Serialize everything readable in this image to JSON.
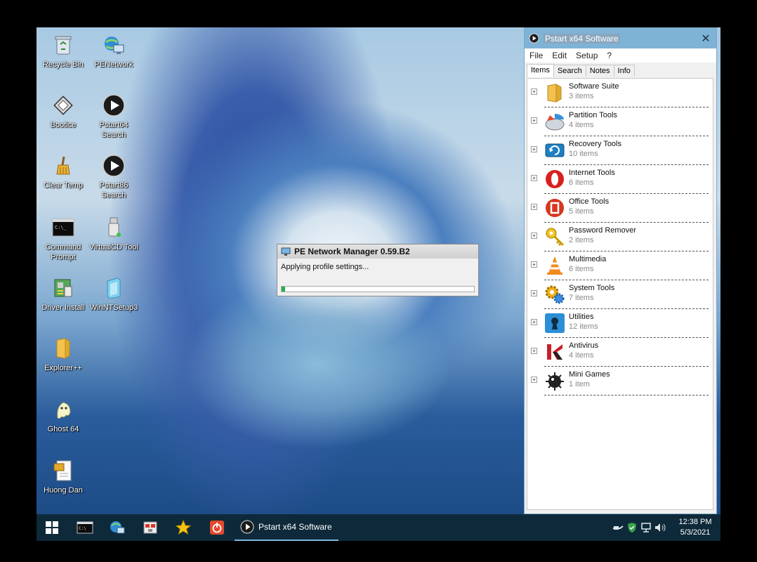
{
  "desktop": {
    "icons": [
      {
        "label": "Recycle Bin"
      },
      {
        "label": "PENetwork"
      },
      {
        "label": "Bootice"
      },
      {
        "label": "Pstart64 Search"
      },
      {
        "label": "Clear Temp"
      },
      {
        "label": "Pstart86 Search"
      },
      {
        "label": "Command Prompt"
      },
      {
        "label": "VirtualCD Tool"
      },
      {
        "label": "Driver Install"
      },
      {
        "label": "WinNTSetup3"
      },
      {
        "label": "Explorer++"
      },
      {
        "label": "Ghost 64"
      },
      {
        "label": "Huong Dan"
      }
    ]
  },
  "pstart": {
    "title": "Pstart x64 Software",
    "menu": [
      "File",
      "Edit",
      "Setup",
      "?"
    ],
    "tabs": [
      "Items",
      "Search",
      "Notes",
      "Info"
    ],
    "active_tab": "Items",
    "items": [
      {
        "name": "Software Suite",
        "count": "3 items",
        "icon": "folder-icon"
      },
      {
        "name": "Partition Tools",
        "count": "4 items",
        "icon": "partition-icon"
      },
      {
        "name": "Recovery Tools",
        "count": "10 items",
        "icon": "recovery-icon"
      },
      {
        "name": "Internet Tools",
        "count": "6 items",
        "icon": "opera-icon"
      },
      {
        "name": "Office Tools",
        "count": "5 items",
        "icon": "office-icon"
      },
      {
        "name": "Password Remover",
        "count": "2 items",
        "icon": "key-icon"
      },
      {
        "name": "Multimedia",
        "count": "6 items",
        "icon": "vlc-cone-icon"
      },
      {
        "name": "System Tools",
        "count": "7 items",
        "icon": "gears-icon"
      },
      {
        "name": "Utilities",
        "count": "12 items",
        "icon": "keyhole-icon"
      },
      {
        "name": "Antivirus",
        "count": "4 items",
        "icon": "kaspersky-icon"
      },
      {
        "name": "Mini Games",
        "count": "1 item",
        "icon": "bomb-icon"
      }
    ]
  },
  "penet_dialog": {
    "title": "PE Network Manager 0.59.B2",
    "message": "Applying profile settings...",
    "progress": 0.02
  },
  "taskbar": {
    "active_window_label": "Pstart x64 Software",
    "clock_time": "12:38 PM",
    "clock_date": "5/3/2021"
  },
  "colors": {
    "taskbar": "#0e2a3a",
    "pstart_titlebar": "#7eb3d6",
    "progress": "#22b14c"
  }
}
